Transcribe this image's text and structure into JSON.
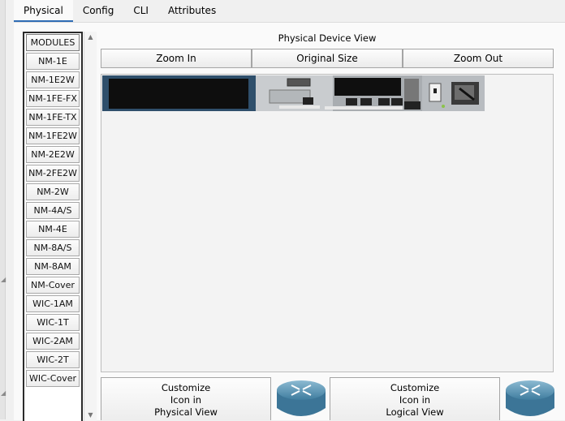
{
  "tabs": [
    {
      "label": "Physical"
    },
    {
      "label": "Config"
    },
    {
      "label": "CLI"
    },
    {
      "label": "Attributes"
    }
  ],
  "modules": {
    "header": "MODULES",
    "items": [
      "NM-1E",
      "NM-1E2W",
      "NM-1FE-FX",
      "NM-1FE-TX",
      "NM-1FE2W",
      "NM-2E2W",
      "NM-2FE2W",
      "NM-2W",
      "NM-4A/S",
      "NM-4E",
      "NM-8A/S",
      "NM-8AM",
      "NM-Cover",
      "WIC-1AM",
      "WIC-1T",
      "WIC-2AM",
      "WIC-2T",
      "WIC-Cover"
    ]
  },
  "device_view": {
    "title": "Physical Device View",
    "zoom_in": "Zoom In",
    "original_size": "Original Size",
    "zoom_out": "Zoom Out"
  },
  "customize_physical": {
    "line1": "Customize",
    "line2": "Icon in",
    "line3": "Physical View"
  },
  "customize_logical": {
    "line1": "Customize",
    "line2": "Icon in",
    "line3": "Logical View"
  },
  "colors": {
    "accent": "#2f6db5",
    "router_icon": "#5b95b7"
  },
  "icons": [
    "router-icon",
    "chevron-up-icon",
    "chevron-down-icon"
  ]
}
